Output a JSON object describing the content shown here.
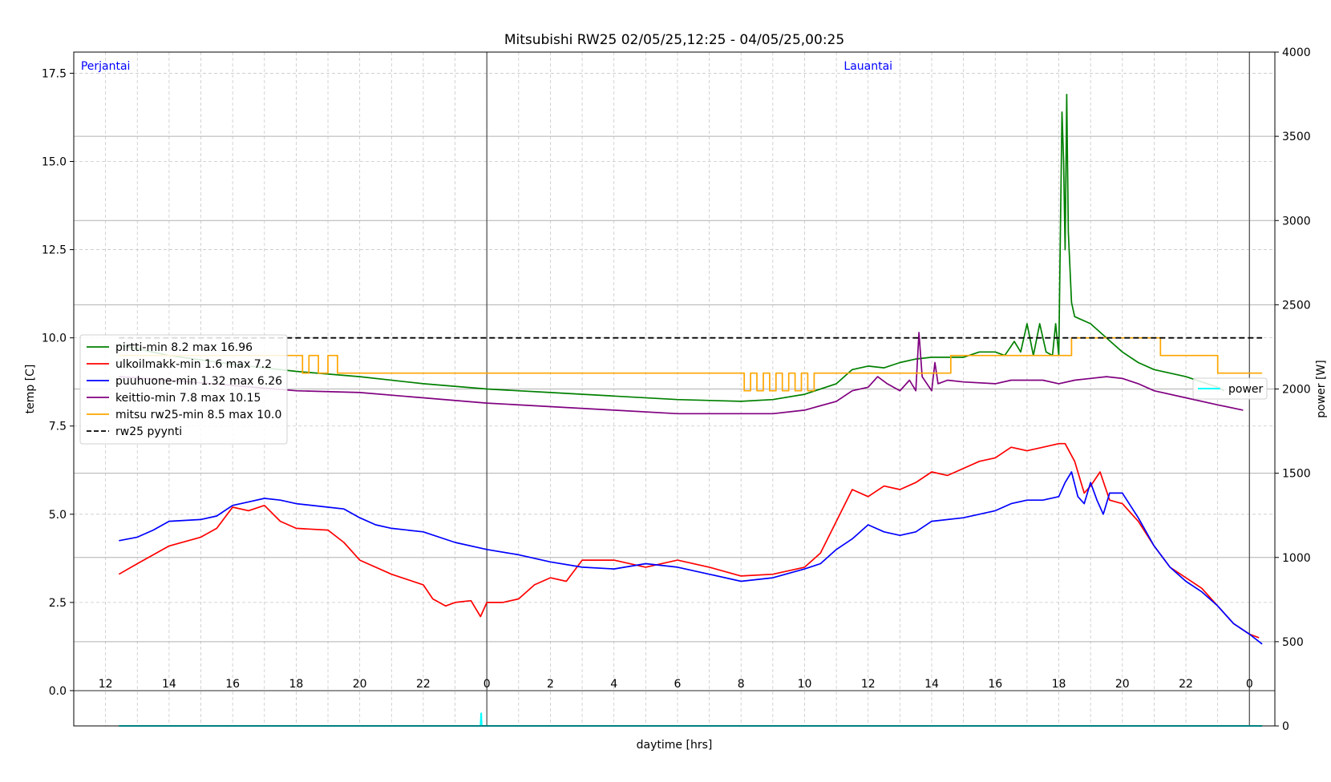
{
  "chart_data": {
    "type": "line",
    "title": "Mitsubishi RW25 02/05/25,12:25 - 04/05/25,00:25",
    "xlabel": "daytime [hrs]",
    "ylabel": "temp [C]",
    "ylabel_right": "power [W]",
    "ylim": [
      -1,
      18.1
    ],
    "ylim_right": [
      0,
      4000
    ],
    "y_ticks": [
      "0.0",
      "2.5",
      "5.0",
      "7.5",
      "10.0",
      "12.5",
      "15.0",
      "17.5"
    ],
    "y_tick_values": [
      0,
      2.5,
      5,
      7.5,
      10,
      12.5,
      15,
      17.5
    ],
    "y_right_ticks": [
      "0",
      "500",
      "1000",
      "1500",
      "2000",
      "2500",
      "3000",
      "3500",
      "4000"
    ],
    "y_right_tick_values": [
      0,
      500,
      1000,
      1500,
      2000,
      2500,
      3000,
      3500,
      4000
    ],
    "x_range": [
      11.0,
      48.8
    ],
    "x_units": "hours since 02/05/25 00:00",
    "hour_ticks": [
      {
        "x": 12,
        "label": "12"
      },
      {
        "x": 14,
        "label": "14"
      },
      {
        "x": 16,
        "label": "16"
      },
      {
        "x": 18,
        "label": "18"
      },
      {
        "x": 20,
        "label": "20"
      },
      {
        "x": 22,
        "label": "22"
      },
      {
        "x": 24,
        "label": "0"
      },
      {
        "x": 26,
        "label": "2"
      },
      {
        "x": 28,
        "label": "4"
      },
      {
        "x": 30,
        "label": "6"
      },
      {
        "x": 32,
        "label": "8"
      },
      {
        "x": 34,
        "label": "10"
      },
      {
        "x": 36,
        "label": "12"
      },
      {
        "x": 38,
        "label": "14"
      },
      {
        "x": 40,
        "label": "16"
      },
      {
        "x": 42,
        "label": "18"
      },
      {
        "x": 44,
        "label": "20"
      },
      {
        "x": 46,
        "label": "22"
      },
      {
        "x": 48,
        "label": "0"
      }
    ],
    "day_labels": [
      {
        "x": 12,
        "label": "Perjantai"
      },
      {
        "x": 36,
        "label": "Lauantai"
      }
    ],
    "midnights": [
      24,
      48
    ],
    "grid": true,
    "legend_position": "left-middle",
    "series": [
      {
        "name": "pirtti-min 8.2 max 16.96",
        "color": "#008000",
        "axis": "left",
        "points": [
          [
            12.42,
            9.8
          ],
          [
            14,
            9.5
          ],
          [
            16,
            9.25
          ],
          [
            18,
            9.05
          ],
          [
            20,
            8.9
          ],
          [
            22,
            8.7
          ],
          [
            24,
            8.55
          ],
          [
            26,
            8.45
          ],
          [
            28,
            8.35
          ],
          [
            30,
            8.25
          ],
          [
            32,
            8.2
          ],
          [
            33,
            8.25
          ],
          [
            34,
            8.4
          ],
          [
            35,
            8.7
          ],
          [
            35.5,
            9.1
          ],
          [
            36,
            9.2
          ],
          [
            36.5,
            9.15
          ],
          [
            37,
            9.3
          ],
          [
            37.5,
            9.4
          ],
          [
            38,
            9.45
          ],
          [
            39,
            9.45
          ],
          [
            39.5,
            9.6
          ],
          [
            40,
            9.6
          ],
          [
            40.3,
            9.5
          ],
          [
            40.6,
            9.9
          ],
          [
            40.8,
            9.6
          ],
          [
            41,
            10.4
          ],
          [
            41.2,
            9.5
          ],
          [
            41.4,
            10.4
          ],
          [
            41.6,
            9.6
          ],
          [
            41.8,
            9.5
          ],
          [
            41.9,
            10.4
          ],
          [
            42,
            9.5
          ],
          [
            42.05,
            13.0
          ],
          [
            42.1,
            16.4
          ],
          [
            42.15,
            15.0
          ],
          [
            42.2,
            12.5
          ],
          [
            42.25,
            16.9
          ],
          [
            42.3,
            13.0
          ],
          [
            42.4,
            11.0
          ],
          [
            42.5,
            10.6
          ],
          [
            43,
            10.4
          ],
          [
            43.5,
            10.0
          ],
          [
            44,
            9.6
          ],
          [
            44.5,
            9.3
          ],
          [
            45,
            9.1
          ],
          [
            46,
            8.9
          ],
          [
            47,
            8.6
          ],
          [
            47.2,
            8.5
          ]
        ]
      },
      {
        "name": "ulkoilmakk-min 1.6 max 7.2",
        "color": "#ff0000",
        "axis": "left",
        "points": [
          [
            12.42,
            3.3
          ],
          [
            13,
            3.6
          ],
          [
            14,
            4.1
          ],
          [
            15,
            4.35
          ],
          [
            15.5,
            4.6
          ],
          [
            16,
            5.2
          ],
          [
            16.5,
            5.1
          ],
          [
            17,
            5.25
          ],
          [
            17.5,
            4.8
          ],
          [
            18,
            4.6
          ],
          [
            19,
            4.55
          ],
          [
            19.5,
            4.2
          ],
          [
            20,
            3.7
          ],
          [
            21,
            3.3
          ],
          [
            22,
            3.0
          ],
          [
            22.3,
            2.6
          ],
          [
            22.7,
            2.4
          ],
          [
            23,
            2.5
          ],
          [
            23.5,
            2.55
          ],
          [
            23.8,
            2.1
          ],
          [
            24,
            2.5
          ],
          [
            24.5,
            2.5
          ],
          [
            25,
            2.6
          ],
          [
            25.5,
            3.0
          ],
          [
            26,
            3.2
          ],
          [
            26.5,
            3.1
          ],
          [
            27,
            3.7
          ],
          [
            28,
            3.7
          ],
          [
            29,
            3.5
          ],
          [
            30,
            3.7
          ],
          [
            31,
            3.5
          ],
          [
            32,
            3.25
          ],
          [
            33,
            3.3
          ],
          [
            34,
            3.5
          ],
          [
            34.5,
            3.9
          ],
          [
            35,
            4.8
          ],
          [
            35.5,
            5.7
          ],
          [
            36,
            5.5
          ],
          [
            36.5,
            5.8
          ],
          [
            37,
            5.7
          ],
          [
            37.5,
            5.9
          ],
          [
            38,
            6.2
          ],
          [
            38.5,
            6.1
          ],
          [
            39,
            6.3
          ],
          [
            39.5,
            6.5
          ],
          [
            40,
            6.6
          ],
          [
            40.5,
            6.9
          ],
          [
            41,
            6.8
          ],
          [
            41.5,
            6.9
          ],
          [
            42,
            7.0
          ],
          [
            42.2,
            7.0
          ],
          [
            42.5,
            6.5
          ],
          [
            42.8,
            5.6
          ],
          [
            43,
            5.8
          ],
          [
            43.3,
            6.2
          ],
          [
            43.6,
            5.4
          ],
          [
            44,
            5.3
          ],
          [
            44.5,
            4.8
          ],
          [
            45,
            4.1
          ],
          [
            45.5,
            3.5
          ],
          [
            46,
            3.2
          ],
          [
            46.5,
            2.9
          ],
          [
            47,
            2.4
          ],
          [
            47.5,
            1.9
          ],
          [
            48,
            1.6
          ],
          [
            48.3,
            1.5
          ]
        ]
      },
      {
        "name": "puuhuone-min 1.32 max 6.26",
        "color": "#0000ff",
        "axis": "left",
        "points": [
          [
            12.42,
            4.25
          ],
          [
            13,
            4.35
          ],
          [
            13.5,
            4.55
          ],
          [
            14,
            4.8
          ],
          [
            15,
            4.85
          ],
          [
            15.5,
            4.95
          ],
          [
            16,
            5.25
          ],
          [
            16.5,
            5.35
          ],
          [
            17,
            5.45
          ],
          [
            17.5,
            5.4
          ],
          [
            18,
            5.3
          ],
          [
            19,
            5.2
          ],
          [
            19.5,
            5.15
          ],
          [
            20,
            4.9
          ],
          [
            20.5,
            4.7
          ],
          [
            21,
            4.6
          ],
          [
            22,
            4.5
          ],
          [
            23,
            4.2
          ],
          [
            24,
            4.0
          ],
          [
            25,
            3.85
          ],
          [
            26,
            3.65
          ],
          [
            27,
            3.5
          ],
          [
            28,
            3.45
          ],
          [
            29,
            3.6
          ],
          [
            30,
            3.5
          ],
          [
            31,
            3.3
          ],
          [
            32,
            3.1
          ],
          [
            33,
            3.2
          ],
          [
            34,
            3.45
          ],
          [
            34.5,
            3.6
          ],
          [
            35,
            4.0
          ],
          [
            35.5,
            4.3
          ],
          [
            36,
            4.7
          ],
          [
            36.5,
            4.5
          ],
          [
            37,
            4.4
          ],
          [
            37.5,
            4.5
          ],
          [
            38,
            4.8
          ],
          [
            39,
            4.9
          ],
          [
            40,
            5.1
          ],
          [
            40.5,
            5.3
          ],
          [
            41,
            5.4
          ],
          [
            41.5,
            5.4
          ],
          [
            42,
            5.5
          ],
          [
            42.2,
            5.9
          ],
          [
            42.4,
            6.2
          ],
          [
            42.6,
            5.5
          ],
          [
            42.8,
            5.3
          ],
          [
            43,
            5.9
          ],
          [
            43.2,
            5.4
          ],
          [
            43.4,
            5.0
          ],
          [
            43.6,
            5.6
          ],
          [
            44,
            5.6
          ],
          [
            44.5,
            4.9
          ],
          [
            45,
            4.1
          ],
          [
            45.5,
            3.5
          ],
          [
            46,
            3.1
          ],
          [
            46.5,
            2.8
          ],
          [
            47,
            2.4
          ],
          [
            47.5,
            1.9
          ],
          [
            48,
            1.6
          ],
          [
            48.4,
            1.32
          ]
        ]
      },
      {
        "name": "keittio-min 7.8 max 10.15",
        "color": "#800080",
        "axis": "left",
        "points": [
          [
            12.42,
            8.9
          ],
          [
            14,
            8.8
          ],
          [
            16,
            8.65
          ],
          [
            18,
            8.5
          ],
          [
            20,
            8.45
          ],
          [
            22,
            8.3
          ],
          [
            24,
            8.15
          ],
          [
            26,
            8.05
          ],
          [
            28,
            7.95
          ],
          [
            30,
            7.85
          ],
          [
            32,
            7.85
          ],
          [
            33,
            7.85
          ],
          [
            34,
            7.95
          ],
          [
            35,
            8.2
          ],
          [
            35.5,
            8.5
          ],
          [
            36,
            8.6
          ],
          [
            36.3,
            8.9
          ],
          [
            36.6,
            8.7
          ],
          [
            37,
            8.5
          ],
          [
            37.3,
            8.8
          ],
          [
            37.5,
            8.5
          ],
          [
            37.6,
            10.15
          ],
          [
            37.7,
            8.9
          ],
          [
            38,
            8.5
          ],
          [
            38.1,
            9.3
          ],
          [
            38.2,
            8.7
          ],
          [
            38.5,
            8.8
          ],
          [
            39,
            8.75
          ],
          [
            40,
            8.7
          ],
          [
            40.5,
            8.8
          ],
          [
            41,
            8.8
          ],
          [
            41.5,
            8.8
          ],
          [
            42,
            8.7
          ],
          [
            42.5,
            8.8
          ],
          [
            43,
            8.85
          ],
          [
            43.5,
            8.9
          ],
          [
            44,
            8.85
          ],
          [
            44.5,
            8.7
          ],
          [
            45,
            8.5
          ],
          [
            46,
            8.3
          ],
          [
            47,
            8.1
          ],
          [
            47.8,
            7.95
          ]
        ]
      },
      {
        "name": "mitsu rw25-min 8.5 max 10.0",
        "color": "#ffa500",
        "axis": "left",
        "step": true,
        "points": [
          [
            12.42,
            9.5
          ],
          [
            18.1,
            9.5
          ],
          [
            18.2,
            9.0
          ],
          [
            18.4,
            9.5
          ],
          [
            18.7,
            9.0
          ],
          [
            18.9,
            9.0
          ],
          [
            19,
            9.5
          ],
          [
            19.3,
            9.0
          ],
          [
            32,
            9.0
          ],
          [
            32.1,
            8.5
          ],
          [
            32.3,
            9.0
          ],
          [
            32.5,
            8.5
          ],
          [
            32.7,
            9.0
          ],
          [
            32.9,
            8.5
          ],
          [
            33.1,
            9.0
          ],
          [
            33.3,
            8.5
          ],
          [
            33.5,
            9.0
          ],
          [
            33.7,
            8.5
          ],
          [
            33.9,
            9.0
          ],
          [
            34.1,
            8.5
          ],
          [
            34.3,
            9.0
          ],
          [
            38.5,
            9.0
          ],
          [
            38.6,
            9.5
          ],
          [
            42.3,
            9.5
          ],
          [
            42.4,
            10.0
          ],
          [
            45.1,
            10.0
          ],
          [
            45.2,
            9.5
          ],
          [
            46.8,
            9.5
          ],
          [
            47,
            9.0
          ],
          [
            48.4,
            9.0
          ]
        ]
      },
      {
        "name": "rw25 pyynti",
        "color": "#000000",
        "axis": "left",
        "dashed": true,
        "points": [
          [
            12.42,
            10.0
          ],
          [
            48.4,
            10.0
          ]
        ]
      },
      {
        "name": "power",
        "color": "#00ffff",
        "axis": "right",
        "points": [
          [
            12.42,
            0
          ],
          [
            23.8,
            0
          ],
          [
            23.82,
            75
          ],
          [
            23.84,
            0
          ],
          [
            48.4,
            0
          ]
        ]
      }
    ]
  }
}
